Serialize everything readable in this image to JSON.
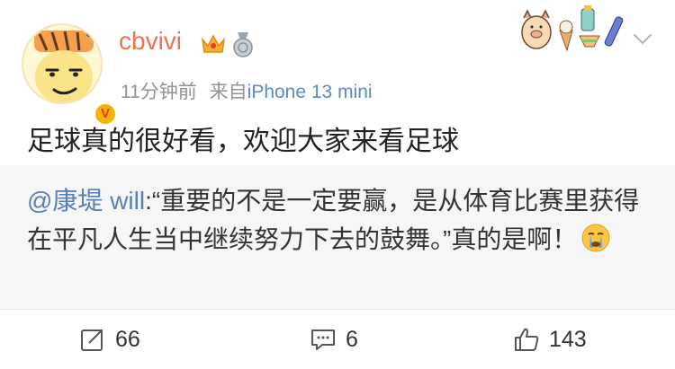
{
  "user": {
    "name": "cbvivi",
    "verified_badge": "V"
  },
  "meta": {
    "time": "11分钟前",
    "source_prefix": "来自",
    "source_device": "iPhone 13 mini"
  },
  "post": {
    "text": "足球真的很好看，欢迎大家来看足球"
  },
  "retweet": {
    "mention": "@康堤 will",
    "text": ":“重要的不是一定要赢，是从体育比赛里获得在平凡人生当中继续努力下去的鼓舞。”真的是啊！"
  },
  "actions": {
    "repost_count": "66",
    "comment_count": "6",
    "like_count": "143"
  },
  "colors": {
    "username": "#eb7350",
    "mention": "#5b7fb5",
    "source": "#5b8ac4",
    "retweet_bg": "#f6f6f6"
  },
  "icons": [
    "avatar-cartoon",
    "crown-icon",
    "medal-icon",
    "decoration-sticker",
    "chevron-down-icon",
    "crying-emoji-icon",
    "repost-icon",
    "comment-icon",
    "like-icon"
  ]
}
